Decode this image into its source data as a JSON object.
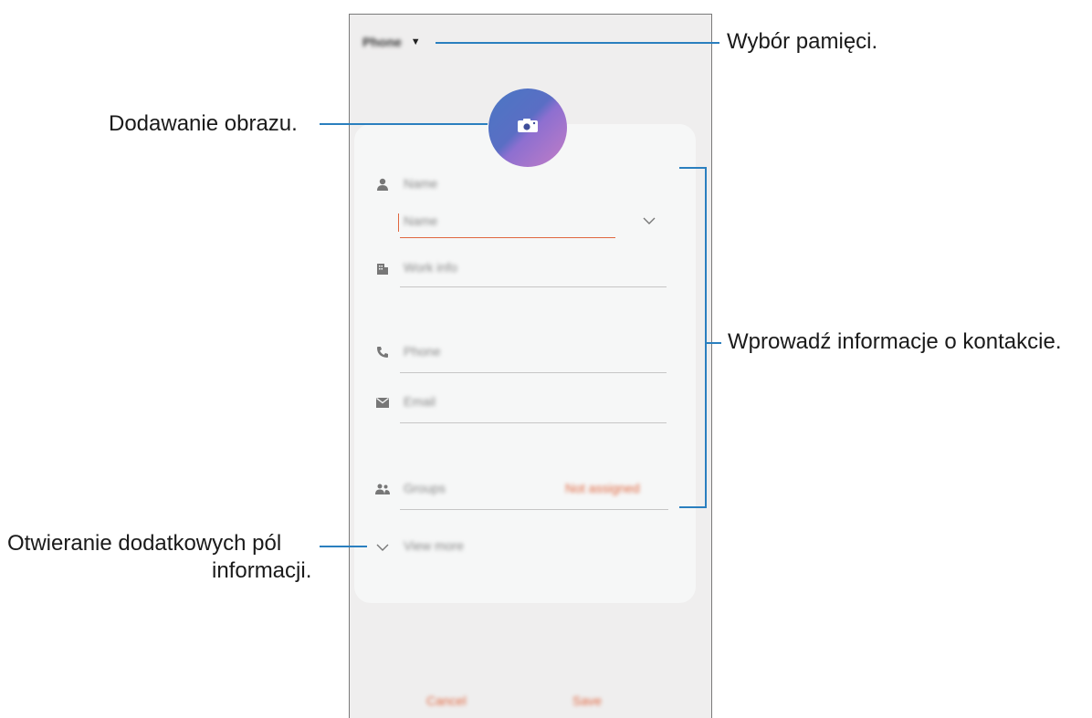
{
  "phone": {
    "storage_label": "Phone",
    "fields": {
      "name": "Name",
      "name_sub": "Name",
      "work_info": "Work info",
      "phone": "Phone",
      "email": "Email",
      "groups": "Groups",
      "groups_value": "Not assigned",
      "view_more": "View more"
    },
    "buttons": {
      "cancel": "Cancel",
      "save": "Save"
    },
    "colors": {
      "accent": "#e0663f",
      "avatar_start": "#4a77c4",
      "avatar_end": "#c47ec6"
    }
  },
  "annotations": {
    "storage": "Wybór pamięci.",
    "image": "Dodawanie obrazu.",
    "contact_info": "Wprowadź informacje o kontakcie.",
    "more_fields_line1": "Otwieranie dodatkowych pól",
    "more_fields_line2": "informacji."
  },
  "icons": [
    "caret-down-icon",
    "camera-icon",
    "person-icon",
    "building-icon",
    "phone-icon",
    "mail-icon",
    "group-icon",
    "chevron-down-icon"
  ]
}
